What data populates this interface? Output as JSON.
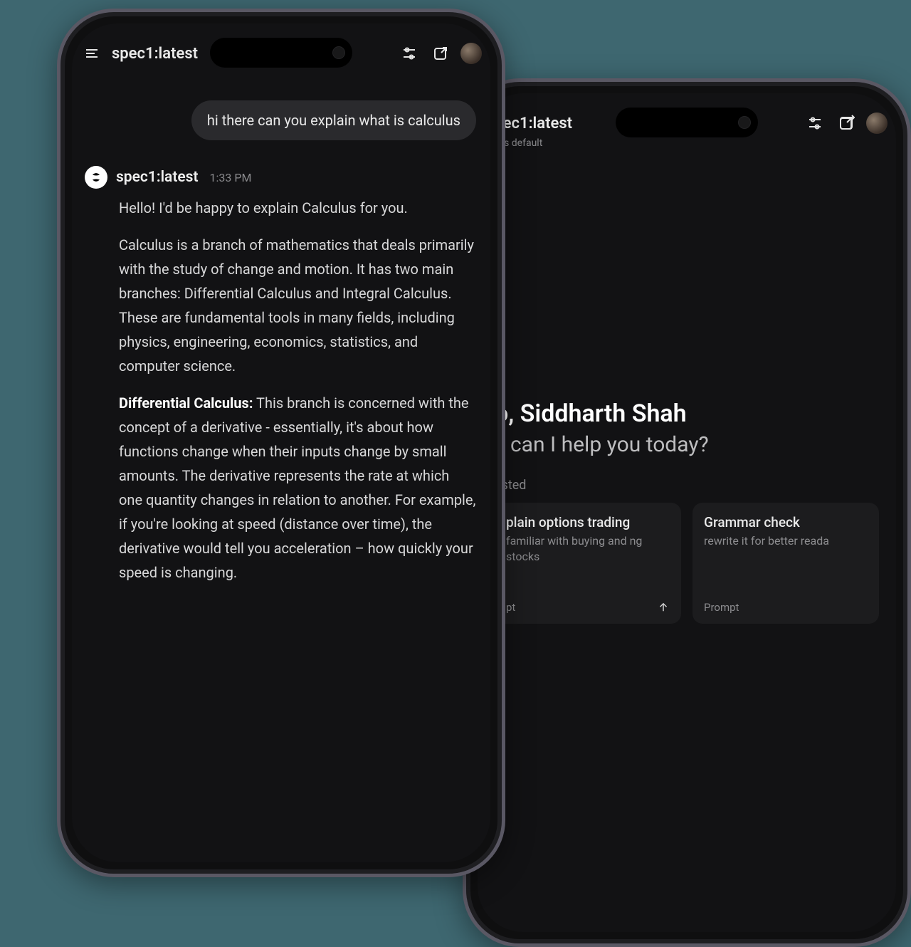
{
  "phone1": {
    "model": "spec1:latest",
    "user_message": "hi there can you explain what is calculus",
    "bot": {
      "name": "spec1:latest",
      "time": "1:33 PM",
      "para1": "Hello! I'd be happy to explain Calculus for you.",
      "para2": "Calculus is a branch of mathematics that deals primarily with the study of change and motion. It has two main branches: Differential Calculus and Integral Calculus. These are fundamental tools in many fields, including physics, engineering, economics, statistics, and computer science.",
      "para3_strong": "Differential Calculus:",
      "para3_rest": " This branch is concerned with the concept of a derivative - essentially, it's about how functions change when their inputs change by small amounts. The derivative represents the rate at which one quantity changes in relation to another. For example, if you're looking at speed (distance over time), the derivative would tell you acceleration – how quickly your speed is changing."
    }
  },
  "phone2": {
    "model": "spec1:latest",
    "subtext": "et as default",
    "hero_title": "o, Siddharth Shah",
    "hero_sub": "v can I help you today?",
    "suggested_label": "ested",
    "cards": [
      {
        "title": "plain options trading",
        "sub": "familiar with buying and ng stocks",
        "footer": "pt"
      },
      {
        "title": "Grammar check",
        "sub": "rewrite it for better reada",
        "footer": "Prompt"
      }
    ]
  }
}
